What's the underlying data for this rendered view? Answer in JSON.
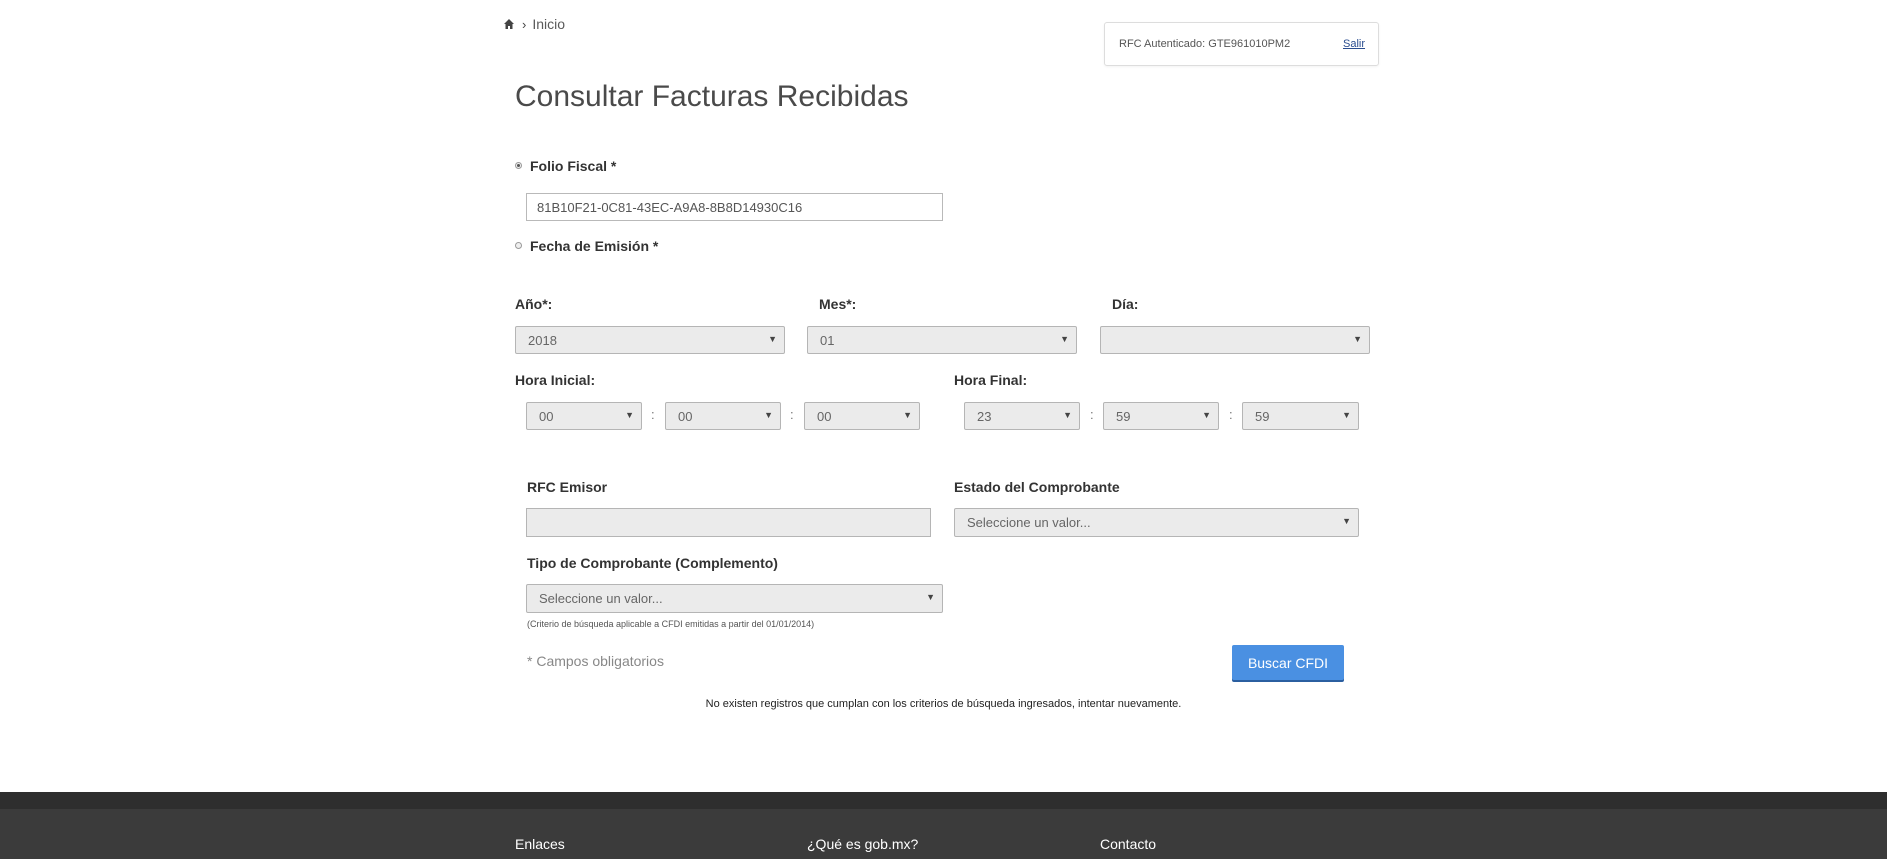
{
  "breadcrumb": {
    "icon": "home-icon",
    "current": "Inicio"
  },
  "auth": {
    "text": "RFC Autenticado: GTE961010PM2",
    "logout": "Salir"
  },
  "title": "Consultar Facturas Recibidas",
  "search_mode": {
    "folio": {
      "label": "Folio Fiscal *",
      "selected": true,
      "value": "81B10F21-0C81-43EC-A9A8-8B8D14930C16"
    },
    "fecha": {
      "label": "Fecha de Emisión *",
      "selected": false
    }
  },
  "date": {
    "year": {
      "label": "Año*:",
      "value": "2018"
    },
    "month": {
      "label": "Mes*:",
      "value": "01"
    },
    "day": {
      "label": "Día:",
      "value": ""
    }
  },
  "time": {
    "start": {
      "label": "Hora Inicial:",
      "hh": "00",
      "mm": "00",
      "ss": "00"
    },
    "end": {
      "label": "Hora Final:",
      "hh": "23",
      "mm": "59",
      "ss": "59"
    },
    "separator": ":"
  },
  "filters": {
    "rfc_emisor": {
      "label": "RFC Emisor",
      "value": ""
    },
    "estado": {
      "label": "Estado del Comprobante",
      "value": "Seleccione un valor..."
    },
    "tipo": {
      "label": "Tipo de Comprobante (Complemento)",
      "value": "Seleccione un valor...",
      "note": "(Criterio de búsqueda aplicable a CFDI emitidas a partir del 01/01/2014)"
    }
  },
  "required_note": "* Campos obligatorios",
  "search_button": "Buscar CFDI",
  "result_message": "No existen registros que cumplan con los criterios de búsqueda ingresados, intentar nuevamente.",
  "footer": {
    "links": "Enlaces",
    "about": "¿Qué es gob.mx?",
    "contact": "Contacto"
  }
}
